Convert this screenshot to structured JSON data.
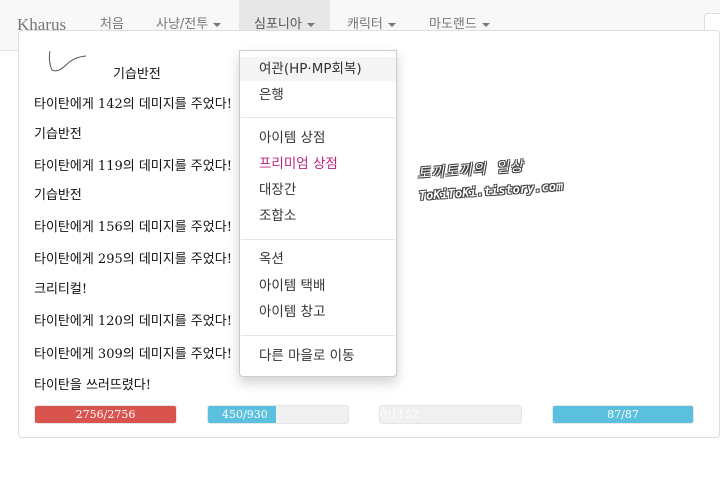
{
  "navbar": {
    "brand": "Kharus",
    "items": [
      {
        "label": "처음"
      },
      {
        "label": "사냥/전투"
      },
      {
        "label": "심포니아"
      },
      {
        "label": "캐릭터"
      },
      {
        "label": "마도랜드"
      }
    ]
  },
  "log": {
    "lines": [
      "기습반전",
      "타이탄에게 142의 데미지를 주었다!",
      "기습반전",
      "타이탄에게 119의 데미지를 주었다!",
      "기습반전",
      "타이탄에게 156의 데미지를 주었다!",
      "타이탄에게 295의 데미지를 주었다!",
      "크리티컬!",
      "타이탄에게 120의 데미지를 주었다!",
      "타이탄에게 309의 데미지를 주었다!",
      "타이탄을 쓰러뜨렸다!"
    ]
  },
  "status_bars": [
    {
      "text": "2756/2756",
      "fraction": 1.0,
      "color": "#d9534f"
    },
    {
      "text": "450/930",
      "fraction": 0.484,
      "color": "#5bc0de"
    },
    {
      "text": "0/1152",
      "fraction": 0.0,
      "color": "#e0e0e0"
    },
    {
      "text": "87/87",
      "fraction": 1.0,
      "color": "#5bc0de"
    }
  ],
  "dropdown": {
    "items": [
      {
        "label": "여관(HP·MP회복)"
      },
      {
        "label": "은행"
      },
      {
        "label": "아이템 상점"
      },
      {
        "label": "프리미엄 상점"
      },
      {
        "label": "대장간"
      },
      {
        "label": "조합소"
      },
      {
        "label": "옥션"
      },
      {
        "label": "아이템 택배"
      },
      {
        "label": "아이템 창고"
      },
      {
        "label": "다른 마을로 이동"
      }
    ]
  },
  "watermark": {
    "line1": "토끼토끼의 일상",
    "line2": "ToKiToKi.tistory.com"
  }
}
